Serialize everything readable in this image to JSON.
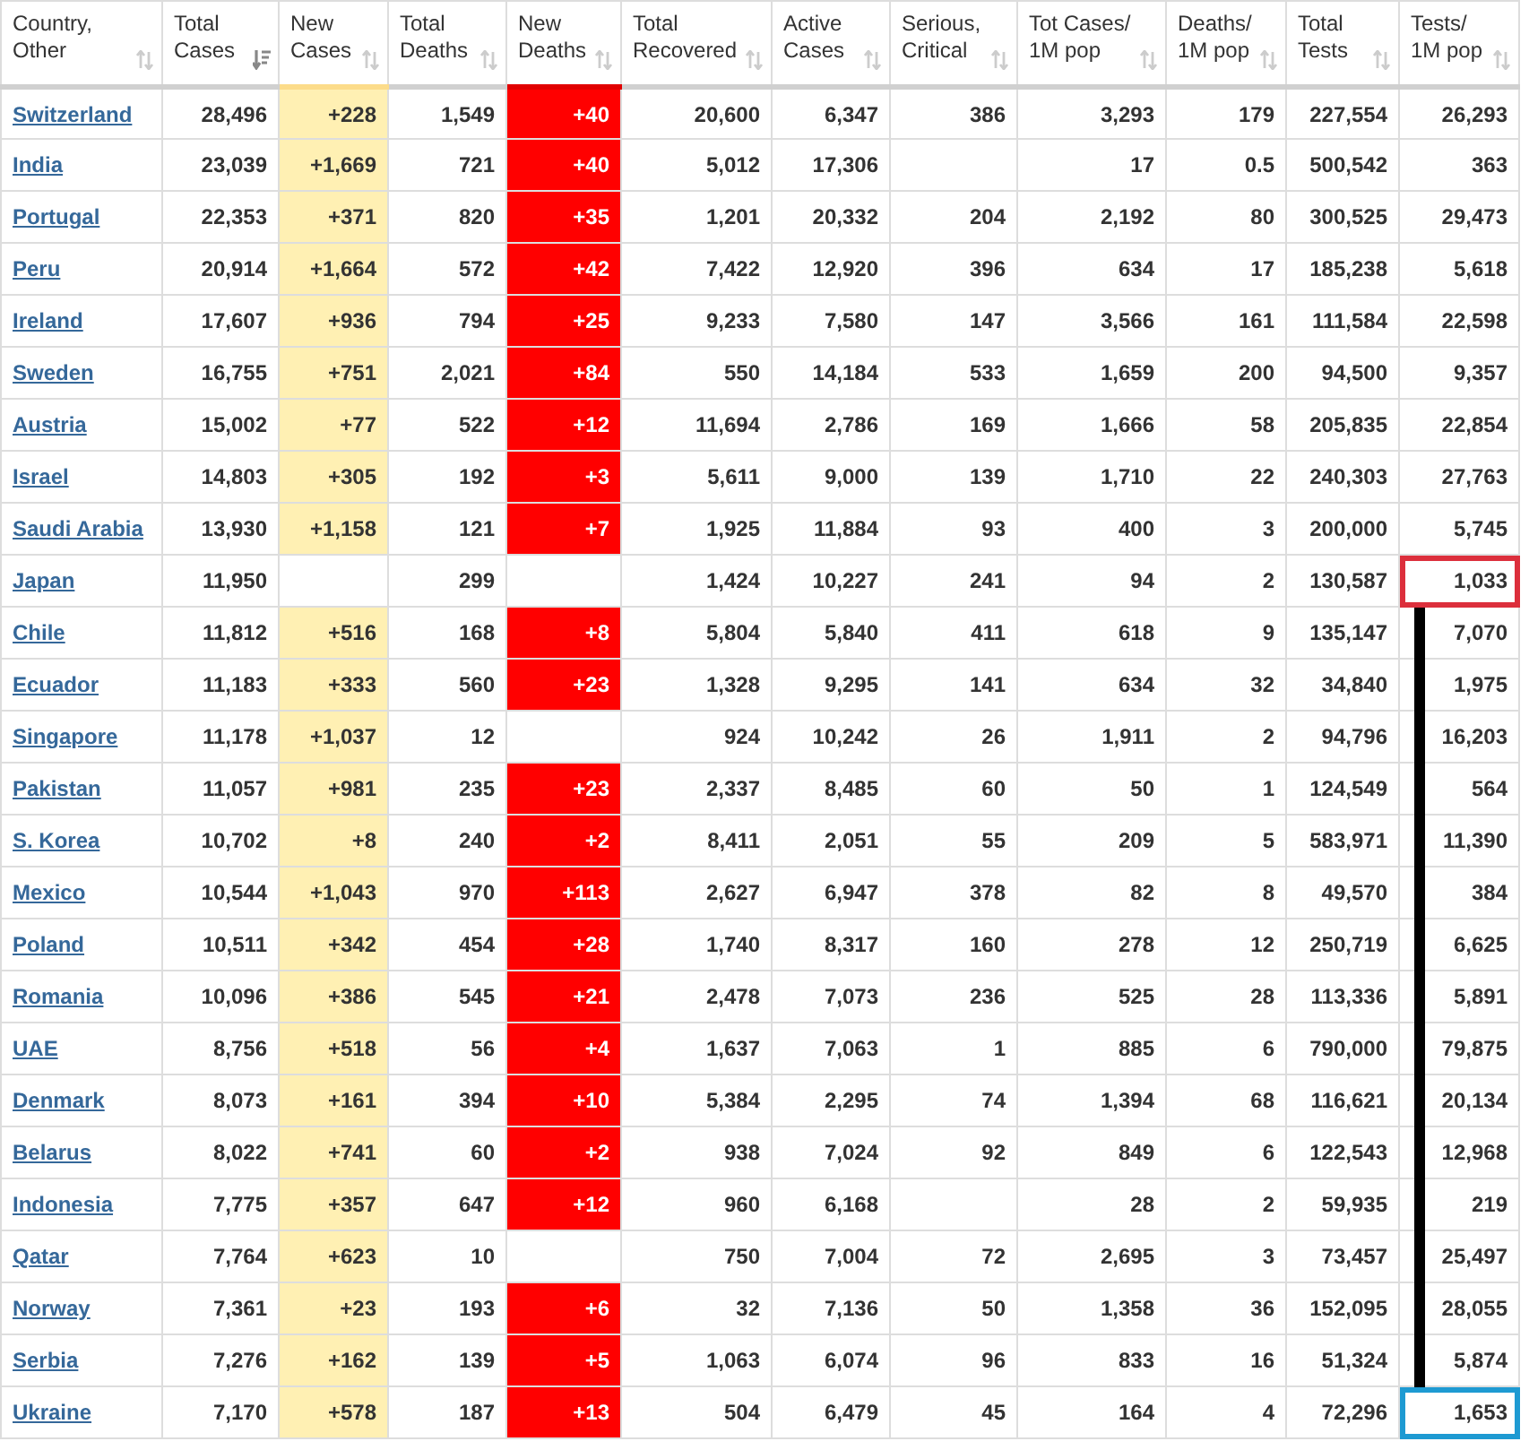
{
  "columns": [
    {
      "label": "Country, Other",
      "sorted": false
    },
    {
      "label": "Total Cases",
      "sorted": true
    },
    {
      "label": "New Cases",
      "sorted": false
    },
    {
      "label": "Total Deaths",
      "sorted": false
    },
    {
      "label": "New Deaths",
      "sorted": false
    },
    {
      "label": "Total Recovered",
      "sorted": false
    },
    {
      "label": "Active Cases",
      "sorted": false
    },
    {
      "label": "Serious, Critical",
      "sorted": false
    },
    {
      "label": "Tot Cases/ 1M pop",
      "sorted": false
    },
    {
      "label": "Deaths/ 1M pop",
      "sorted": false
    },
    {
      "label": "Total Tests",
      "sorted": false
    },
    {
      "label": "Tests/ 1M pop",
      "sorted": false
    }
  ],
  "rows": [
    {
      "cells": [
        "Switzerland",
        "28,496",
        "+228",
        "1,549",
        "+40",
        "20,600",
        "6,347",
        "386",
        "3,293",
        "179",
        "227,554",
        "26,293"
      ]
    },
    {
      "cells": [
        "India",
        "23,039",
        "+1,669",
        "721",
        "+40",
        "5,012",
        "17,306",
        "",
        "17",
        "0.5",
        "500,542",
        "363"
      ]
    },
    {
      "cells": [
        "Portugal",
        "22,353",
        "+371",
        "820",
        "+35",
        "1,201",
        "20,332",
        "204",
        "2,192",
        "80",
        "300,525",
        "29,473"
      ]
    },
    {
      "cells": [
        "Peru",
        "20,914",
        "+1,664",
        "572",
        "+42",
        "7,422",
        "12,920",
        "396",
        "634",
        "17",
        "185,238",
        "5,618"
      ]
    },
    {
      "cells": [
        "Ireland",
        "17,607",
        "+936",
        "794",
        "+25",
        "9,233",
        "7,580",
        "147",
        "3,566",
        "161",
        "111,584",
        "22,598"
      ]
    },
    {
      "cells": [
        "Sweden",
        "16,755",
        "+751",
        "2,021",
        "+84",
        "550",
        "14,184",
        "533",
        "1,659",
        "200",
        "94,500",
        "9,357"
      ]
    },
    {
      "cells": [
        "Austria",
        "15,002",
        "+77",
        "522",
        "+12",
        "11,694",
        "2,786",
        "169",
        "1,666",
        "58",
        "205,835",
        "22,854"
      ]
    },
    {
      "cells": [
        "Israel",
        "14,803",
        "+305",
        "192",
        "+3",
        "5,611",
        "9,000",
        "139",
        "1,710",
        "22",
        "240,303",
        "27,763"
      ]
    },
    {
      "cells": [
        "Saudi Arabia",
        "13,930",
        "+1,158",
        "121",
        "+7",
        "1,925",
        "11,884",
        "93",
        "400",
        "3",
        "200,000",
        "5,745"
      ]
    },
    {
      "cells": [
        "Japan",
        "11,950",
        "",
        "299",
        "",
        "1,424",
        "10,227",
        "241",
        "94",
        "2",
        "130,587",
        "1,033"
      ],
      "color": "#dc2f3c"
    },
    {
      "cells": [
        "Chile",
        "11,812",
        "+516",
        "168",
        "+8",
        "5,804",
        "5,840",
        "411",
        "618",
        "9",
        "135,147",
        "7,070"
      ]
    },
    {
      "cells": [
        "Ecuador",
        "11,183",
        "+333",
        "560",
        "+23",
        "1,328",
        "9,295",
        "141",
        "634",
        "32",
        "34,840",
        "1,975"
      ]
    },
    {
      "cells": [
        "Singapore",
        "11,178",
        "+1,037",
        "12",
        "",
        "924",
        "10,242",
        "26",
        "1,911",
        "2",
        "94,796",
        "16,203"
      ]
    },
    {
      "cells": [
        "Pakistan",
        "11,057",
        "+981",
        "235",
        "+23",
        "2,337",
        "8,485",
        "60",
        "50",
        "1",
        "124,549",
        "564"
      ]
    },
    {
      "cells": [
        "S. Korea",
        "10,702",
        "+8",
        "240",
        "+2",
        "8,411",
        "2,051",
        "55",
        "209",
        "5",
        "583,971",
        "11,390"
      ]
    },
    {
      "cells": [
        "Mexico",
        "10,544",
        "+1,043",
        "970",
        "+113",
        "2,627",
        "6,947",
        "378",
        "82",
        "8",
        "49,570",
        "384"
      ]
    },
    {
      "cells": [
        "Poland",
        "10,511",
        "+342",
        "454",
        "+28",
        "1,740",
        "8,317",
        "160",
        "278",
        "12",
        "250,719",
        "6,625"
      ]
    },
    {
      "cells": [
        "Romania",
        "10,096",
        "+386",
        "545",
        "+21",
        "2,478",
        "7,073",
        "236",
        "525",
        "28",
        "113,336",
        "5,891"
      ]
    },
    {
      "cells": [
        "UAE",
        "8,756",
        "+518",
        "56",
        "+4",
        "1,637",
        "7,063",
        "1",
        "885",
        "6",
        "790,000",
        "79,875"
      ]
    },
    {
      "cells": [
        "Denmark",
        "8,073",
        "+161",
        "394",
        "+10",
        "5,384",
        "2,295",
        "74",
        "1,394",
        "68",
        "116,621",
        "20,134"
      ]
    },
    {
      "cells": [
        "Belarus",
        "8,022",
        "+741",
        "60",
        "+2",
        "938",
        "7,024",
        "92",
        "849",
        "6",
        "122,543",
        "12,968"
      ]
    },
    {
      "cells": [
        "Indonesia",
        "7,775",
        "+357",
        "647",
        "+12",
        "960",
        "6,168",
        "",
        "28",
        "2",
        "59,935",
        "219"
      ]
    },
    {
      "cells": [
        "Qatar",
        "7,764",
        "+623",
        "10",
        "",
        "750",
        "7,004",
        "72",
        "2,695",
        "3",
        "73,457",
        "25,497"
      ]
    },
    {
      "cells": [
        "Norway",
        "7,361",
        "+23",
        "193",
        "+6",
        "32",
        "7,136",
        "50",
        "1,358",
        "36",
        "152,095",
        "28,055"
      ]
    },
    {
      "cells": [
        "Serbia",
        "7,276",
        "+162",
        "139",
        "+5",
        "1,063",
        "6,074",
        "96",
        "833",
        "16",
        "51,324",
        "5,874"
      ]
    },
    {
      "cells": [
        "Ukraine",
        "7,170",
        "+578",
        "187",
        "+13",
        "504",
        "6,479",
        "45",
        "164",
        "4",
        "72,296",
        "1,653"
      ],
      "color": "#1e9ad2"
    }
  ]
}
